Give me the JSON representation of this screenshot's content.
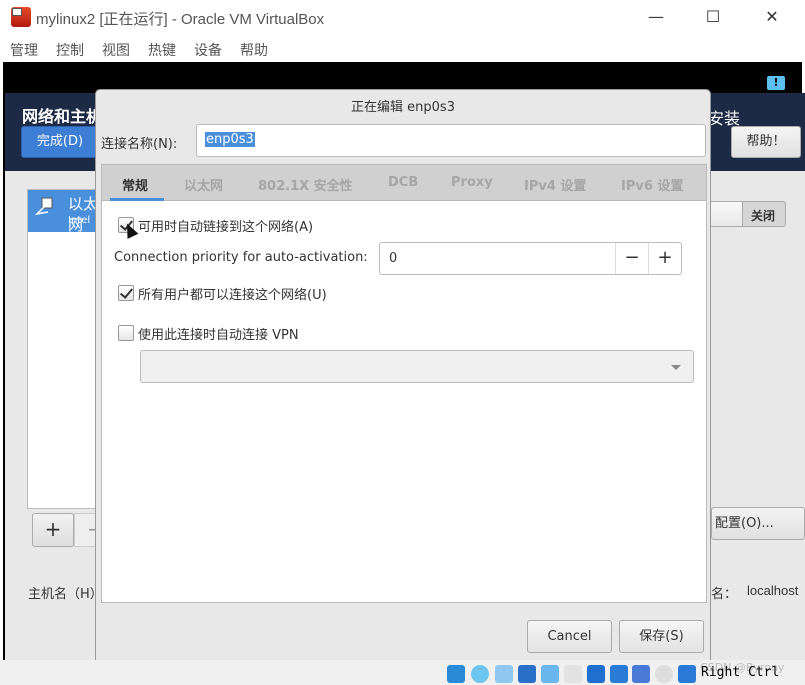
{
  "window": {
    "title": "mylinux2 [正在运行] - Oracle VM VirtualBox",
    "controls": {
      "minimize": "—",
      "maximize": "☐",
      "close": "✕"
    }
  },
  "menu": [
    "管理",
    "控制",
    "视图",
    "热键",
    "设备",
    "帮助"
  ],
  "background": {
    "title": "网络和主机名",
    "title_right": "安装",
    "done_button": "完成(D)",
    "help_button": "帮助！",
    "connection": {
      "name": "以太网",
      "subtitle": "Intel"
    },
    "switch_label": "关闭",
    "add_button": "+",
    "remove_button": "−",
    "config_button": "配置(O)...",
    "hostname_label": "主机名（H）：",
    "current_hostname_label": "名：",
    "current_hostname": "localhost"
  },
  "dialog": {
    "title": "正在编辑 enp0s3",
    "name_label": "连接名称(N):",
    "name_value": "enp0s3",
    "tabs": [
      {
        "label": "常规",
        "active": true
      },
      {
        "label": "以太网",
        "active": false
      },
      {
        "label": "802.1X 安全性",
        "active": false
      },
      {
        "label": "DCB",
        "active": false
      },
      {
        "label": "Proxy",
        "active": false
      },
      {
        "label": "IPv4 设置",
        "active": false
      },
      {
        "label": "IPv6 设置",
        "active": false
      }
    ],
    "auto_connect": {
      "label": "可用时自动链接到这个网络(A)",
      "checked": true
    },
    "priority_label": "Connection priority for auto-activation:",
    "priority_value": "0",
    "all_users": {
      "label": "所有用户都可以连接这个网络(U)",
      "checked": true
    },
    "vpn": {
      "label": "使用此连接时自动连接 VPN",
      "checked": false,
      "selected": ""
    },
    "cancel_button": "Cancel",
    "save_button": "保存(S)"
  },
  "statusbar": {
    "host_key": "Right Ctrl",
    "watermark": "CSDN @Byrony"
  }
}
